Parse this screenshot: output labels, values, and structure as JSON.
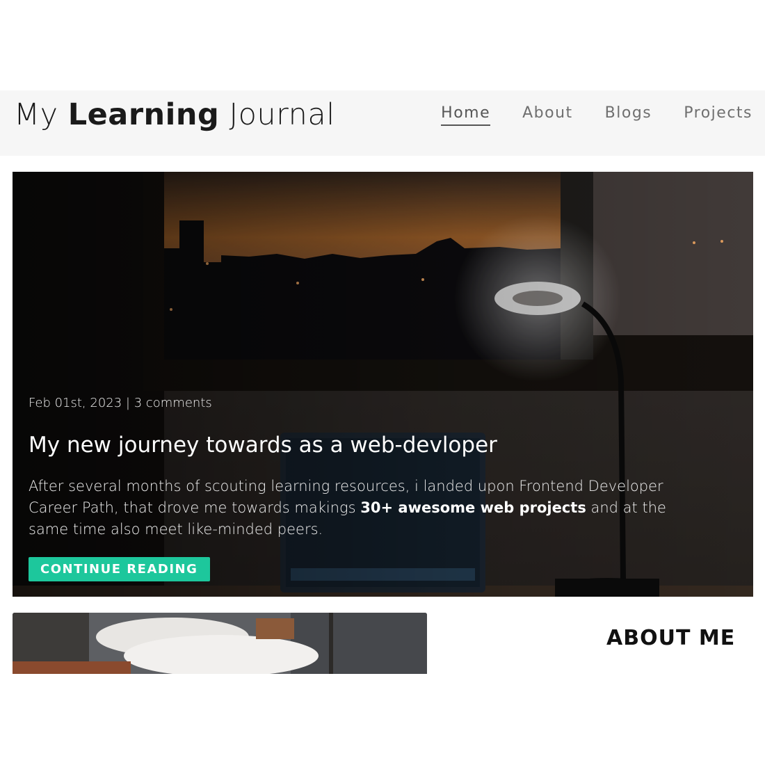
{
  "header": {
    "brand": {
      "prefix": "My",
      "bold": "Learning",
      "suffix": "Journal"
    },
    "nav": [
      {
        "label": "Home",
        "active": true
      },
      {
        "label": "About",
        "active": false
      },
      {
        "label": "Blogs",
        "active": false
      },
      {
        "label": "Projects",
        "active": false
      }
    ]
  },
  "hero": {
    "meta": "Feb 01st, 2023 | 3 comments",
    "title": "My new journey towards as a web-devloper",
    "text_before": "After several months of scouting learning resources, i landed upon Frontend Developer Career Path, that drove me towards makings ",
    "text_strong": "30+ awesome web projects",
    "text_after": " and at the same time also meet like-minded peers.",
    "cta": "CONTINUE READING"
  },
  "sidebar": {
    "about_heading": "ABOUT ME"
  },
  "colors": {
    "accent": "#1dc79c",
    "header_bg": "#f6f6f6",
    "nav_text": "#6f6f6f"
  }
}
